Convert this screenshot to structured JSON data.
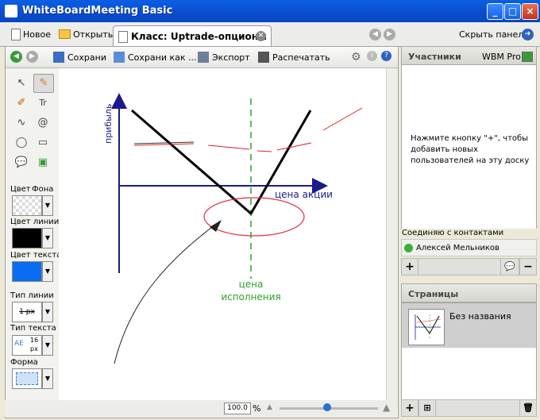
{
  "window": {
    "title": "WhiteBoardMeeting Basic"
  },
  "tabbar": {
    "new_label": "Новое",
    "open_label": "Открыть",
    "active_tab": "Класс: Uptrade-опционы",
    "hide_panels": "Скрыть панели"
  },
  "toolbar": {
    "save": "Сохрани",
    "save_as": "Сохрани как ...",
    "export": "Экспорт",
    "print": "Распечатать"
  },
  "tools": {
    "color_label": "Цвет",
    "background_label": "Фона",
    "line_color_label": "Цвет линии",
    "text_color_label": "Цвет текста",
    "line_type_label": "Тип линии",
    "line_type_value": "1 px",
    "text_type_label": "Тип текста",
    "text_size": "16",
    "text_unit": "px",
    "text_sample": "AE",
    "shape_label": "Форма",
    "line_color": "#000000",
    "text_color": "#0a6cf0"
  },
  "canvas": {
    "y_axis_label": "прибыль",
    "x_axis_label": "цена акции",
    "strike_label_line1": "цена",
    "strike_label_line2": "исполнения"
  },
  "status": {
    "zoom": "100.0",
    "zoom_unit": "%"
  },
  "participants": {
    "title": "Участники",
    "plan": "WBM Pro",
    "hint": "Нажмите кнопку \"+\", чтобы добавить новых пользователей на эту доску",
    "connecting": "Соединяю с контактами",
    "contact_name": "Алексей Мельников"
  },
  "pages": {
    "title": "Страницы",
    "page_name": "Без названия"
  }
}
